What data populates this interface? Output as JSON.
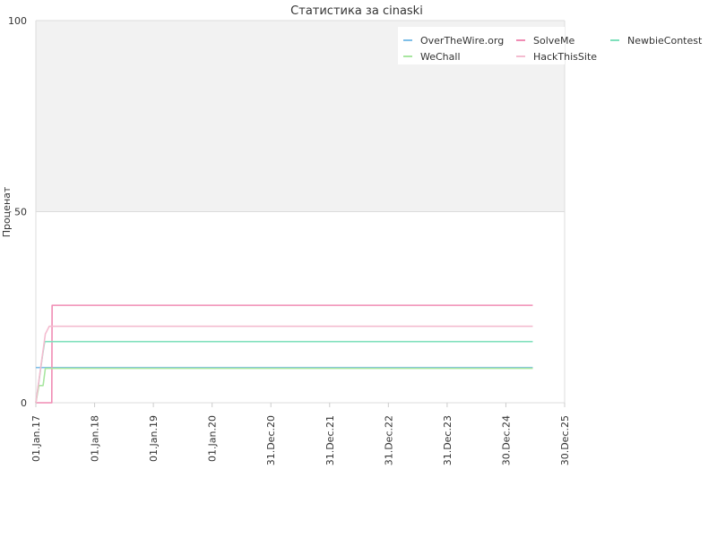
{
  "chart_data": {
    "type": "line",
    "title": "Статистика за cinaski",
    "xlabel": "",
    "ylabel": "Проценат",
    "ylim": [
      0,
      100
    ],
    "yticks": [
      0,
      50,
      100
    ],
    "xlim": [
      "2017-01-01",
      "2025-12-30"
    ],
    "xticks": [
      {
        "date": "2017-01-01",
        "label": "01.Jan.17"
      },
      {
        "date": "2018-01-01",
        "label": "01.Jan.18"
      },
      {
        "date": "2019-01-01",
        "label": "01.Jan.19"
      },
      {
        "date": "2020-01-01",
        "label": "01.Jan.20"
      },
      {
        "date": "2020-12-31",
        "label": "31.Dec.20"
      },
      {
        "date": "2021-12-31",
        "label": "31.Dec.21"
      },
      {
        "date": "2022-12-31",
        "label": "31.Dec.22"
      },
      {
        "date": "2023-12-31",
        "label": "31.Dec.23"
      },
      {
        "date": "2024-12-30",
        "label": "30.Dec.24"
      },
      {
        "date": "2025-12-30",
        "label": "30.Dec.25"
      }
    ],
    "bands": [
      {
        "from": 50,
        "to": 100,
        "color": "#f2f2f2"
      }
    ],
    "legend_position": "top-right",
    "series": [
      {
        "name": "OverTheWire.org",
        "color": "#7fbfe8",
        "points": [
          [
            "2017-01-01",
            9.2
          ],
          [
            "2025-06-15",
            9.2
          ]
        ]
      },
      {
        "name": "SolveMe",
        "color": "#f08cb4",
        "points": [
          [
            "2017-01-01",
            0
          ],
          [
            "2017-04-10",
            0
          ],
          [
            "2017-04-12",
            25.5
          ],
          [
            "2025-06-15",
            25.5
          ]
        ]
      },
      {
        "name": "NewbieContest",
        "color": "#7fe0bc",
        "points": [
          [
            "2017-01-01",
            0
          ],
          [
            "2017-01-15",
            4
          ],
          [
            "2017-02-10",
            12
          ],
          [
            "2017-02-25",
            16
          ],
          [
            "2025-06-15",
            16
          ]
        ]
      },
      {
        "name": "WeChall",
        "color": "#a8e6a0",
        "points": [
          [
            "2017-01-01",
            0
          ],
          [
            "2017-01-20",
            4.5
          ],
          [
            "2017-02-15",
            4.5
          ],
          [
            "2017-03-01",
            9
          ],
          [
            "2025-06-15",
            9
          ]
        ]
      },
      {
        "name": "HackThisSite",
        "color": "#f4bcd0",
        "points": [
          [
            "2017-01-01",
            0
          ],
          [
            "2017-03-01",
            18
          ],
          [
            "2017-03-25",
            20
          ],
          [
            "2025-06-15",
            20
          ]
        ]
      }
    ]
  }
}
